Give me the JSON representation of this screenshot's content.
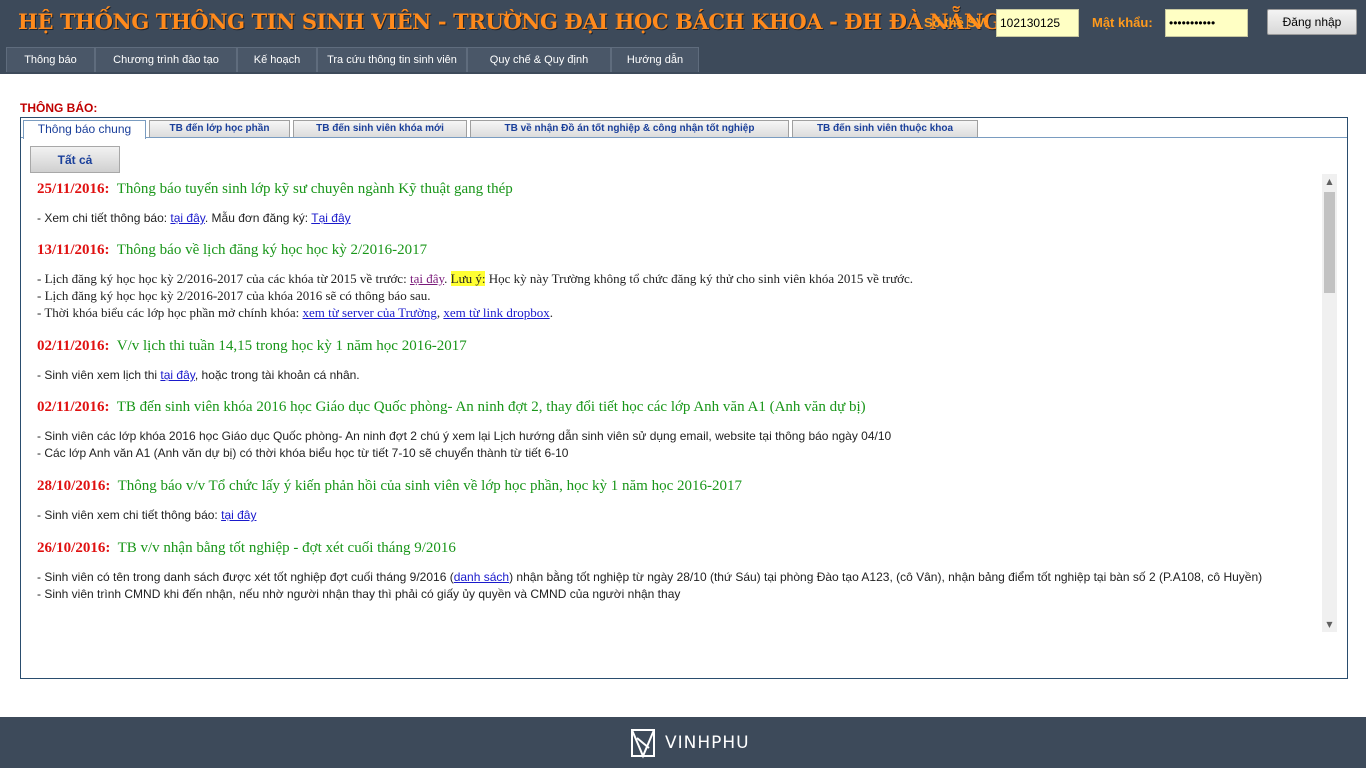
{
  "header": {
    "title": "HỆ THỐNG THÔNG TIN SINH VIÊN - TRƯỜNG ĐẠI HỌC BÁCH KHOA - ĐH ĐÀ NẴNG",
    "sv_label": "Số thẻ SV:",
    "sv_value": "102130125",
    "pw_label": "Mật khẩu:",
    "pw_value": "•••••••••••",
    "login_label": "Đăng nhập"
  },
  "nav": [
    "Thông báo",
    "Chương trình đào tạo",
    "Kế hoạch",
    "Tra cứu thông tin sinh viên",
    "Quy chế & Quy định",
    "Hướng dẫn"
  ],
  "section_title": "THÔNG BÁO:",
  "tabs": [
    "Thông báo chung",
    "TB đến lớp học phần",
    "TB đến sinh viên khóa mới",
    "TB về nhận Đồ án tốt nghiệp & công nhận tốt nghiệp",
    "TB đến sinh viên thuộc khoa"
  ],
  "all_label": "Tất cả",
  "news": {
    "n1": {
      "date": "25/11/2016:",
      "title": "Thông báo tuyển sinh lớp kỹ sư chuyên ngành Kỹ thuật gang thép",
      "l1a": "- Xem chi tiết thông báo: ",
      "l1b": "tại đây",
      "l1c": ". Mẫu đơn đăng ký: ",
      "l1d": "Tại đây"
    },
    "n2": {
      "date": "13/11/2016:",
      "title": "Thông báo về lịch đăng ký học học kỳ 2/2016-2017",
      "l1a": "- Lịch đăng ký học học kỳ 2/2016-2017 của các khóa từ 2015 về trước: ",
      "l1b": "tại đây",
      "l1c": ". ",
      "l1d": "Lưu ý:",
      "l1e": " Học kỳ này Trường không tổ chức đăng ký thử cho sinh viên khóa 2015 về trước.",
      "l2": "- Lịch đăng ký học học kỳ 2/2016-2017 của khóa 2016 sẽ có thông báo sau.",
      "l3a": "- Thời khóa biểu các lớp học phần mở chính khóa: ",
      "l3b": "xem từ server của Trường",
      "l3c": ", ",
      "l3d": "xem từ link dropbox",
      "l3e": "."
    },
    "n3": {
      "date": "02/11/2016:",
      "title": "V/v lịch thi tuần 14,15 trong học kỳ 1 năm học 2016-2017",
      "l1a": "- Sinh viên xem lịch thi ",
      "l1b": "tại đây",
      "l1c": ", hoặc trong tài khoản cá nhân."
    },
    "n4": {
      "date": "02/11/2016:",
      "title": "TB đến sinh viên khóa 2016 học Giáo dục Quốc phòng- An ninh đợt 2, thay đổi tiết học các lớp Anh văn A1 (Anh văn dự bị)",
      "l1": "- Sinh viên các lớp khóa 2016 học Giáo dục Quốc phòng- An ninh đợt 2 chú ý xem lại Lịch hướng dẫn sinh viên sử dụng email, website tại thông báo ngày 04/10",
      "l2": "- Các lớp Anh văn A1 (Anh văn dự bị) có thời khóa biểu học từ tiết 7-10 sẽ chuyển thành từ tiết 6-10"
    },
    "n5": {
      "date": "28/10/2016:",
      "title": "Thông báo v/v Tổ chức lấy ý kiến phản hồi của sinh viên về lớp học phần, học kỳ 1 năm học 2016-2017",
      "l1a": "- Sinh viên xem chi tiết thông báo: ",
      "l1b": "tại đây"
    },
    "n6": {
      "date": "26/10/2016:",
      "title": "TB v/v nhận bằng tốt nghiệp - đợt xét cuối tháng 9/2016",
      "l1a": "- Sinh viên có tên trong danh sách được xét tốt nghiệp đợt cuối tháng 9/2016 (",
      "l1b": "danh sách",
      "l1c": ") nhận bằng tốt nghiệp từ ngày 28/10 (thứ Sáu) tại phòng Đào tạo A123, (cô Vân), nhận bảng điểm tốt nghiệp tại bàn số 2 (P.A108, cô Huyền)",
      "l2": "- Sinh viên trình CMND khi đến nhận, nếu nhờ người nhận thay thì phải có giấy ủy quyền và CMND của người nhận thay"
    }
  },
  "footer": {
    "logo_text": "VINHPHU"
  },
  "colors": {
    "header_bg": "#3d4a5a",
    "title_orange": "#ff8a1c",
    "date_red": "#e01010",
    "headline_green": "#199619",
    "link_blue": "#1a1acc",
    "highlight_yellow": "#ffff33"
  }
}
